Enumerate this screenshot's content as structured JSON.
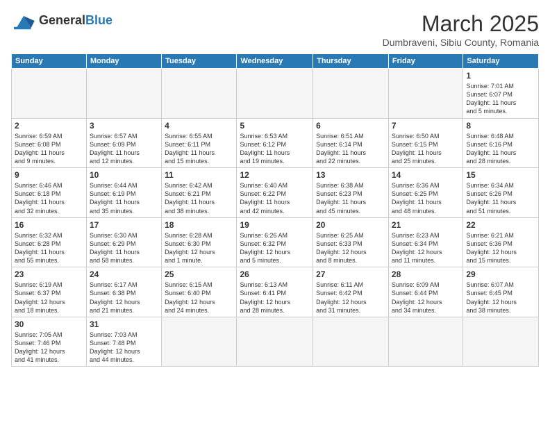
{
  "logo": {
    "text_general": "General",
    "text_blue": "Blue"
  },
  "header": {
    "month_year": "March 2025",
    "location": "Dumbraveni, Sibiu County, Romania"
  },
  "weekdays": [
    "Sunday",
    "Monday",
    "Tuesday",
    "Wednesday",
    "Thursday",
    "Friday",
    "Saturday"
  ],
  "weeks": [
    [
      null,
      null,
      null,
      null,
      null,
      null,
      {
        "day": "1",
        "info": "Sunrise: 7:01 AM\nSunset: 6:07 PM\nDaylight: 11 hours\nand 5 minutes."
      }
    ],
    [
      {
        "day": "2",
        "info": "Sunrise: 6:59 AM\nSunset: 6:08 PM\nDaylight: 11 hours\nand 9 minutes."
      },
      {
        "day": "3",
        "info": "Sunrise: 6:57 AM\nSunset: 6:09 PM\nDaylight: 11 hours\nand 12 minutes."
      },
      {
        "day": "4",
        "info": "Sunrise: 6:55 AM\nSunset: 6:11 PM\nDaylight: 11 hours\nand 15 minutes."
      },
      {
        "day": "5",
        "info": "Sunrise: 6:53 AM\nSunset: 6:12 PM\nDaylight: 11 hours\nand 19 minutes."
      },
      {
        "day": "6",
        "info": "Sunrise: 6:51 AM\nSunset: 6:14 PM\nDaylight: 11 hours\nand 22 minutes."
      },
      {
        "day": "7",
        "info": "Sunrise: 6:50 AM\nSunset: 6:15 PM\nDaylight: 11 hours\nand 25 minutes."
      },
      {
        "day": "8",
        "info": "Sunrise: 6:48 AM\nSunset: 6:16 PM\nDaylight: 11 hours\nand 28 minutes."
      }
    ],
    [
      {
        "day": "9",
        "info": "Sunrise: 6:46 AM\nSunset: 6:18 PM\nDaylight: 11 hours\nand 32 minutes."
      },
      {
        "day": "10",
        "info": "Sunrise: 6:44 AM\nSunset: 6:19 PM\nDaylight: 11 hours\nand 35 minutes."
      },
      {
        "day": "11",
        "info": "Sunrise: 6:42 AM\nSunset: 6:21 PM\nDaylight: 11 hours\nand 38 minutes."
      },
      {
        "day": "12",
        "info": "Sunrise: 6:40 AM\nSunset: 6:22 PM\nDaylight: 11 hours\nand 42 minutes."
      },
      {
        "day": "13",
        "info": "Sunrise: 6:38 AM\nSunset: 6:23 PM\nDaylight: 11 hours\nand 45 minutes."
      },
      {
        "day": "14",
        "info": "Sunrise: 6:36 AM\nSunset: 6:25 PM\nDaylight: 11 hours\nand 48 minutes."
      },
      {
        "day": "15",
        "info": "Sunrise: 6:34 AM\nSunset: 6:26 PM\nDaylight: 11 hours\nand 51 minutes."
      }
    ],
    [
      {
        "day": "16",
        "info": "Sunrise: 6:32 AM\nSunset: 6:28 PM\nDaylight: 11 hours\nand 55 minutes."
      },
      {
        "day": "17",
        "info": "Sunrise: 6:30 AM\nSunset: 6:29 PM\nDaylight: 11 hours\nand 58 minutes."
      },
      {
        "day": "18",
        "info": "Sunrise: 6:28 AM\nSunset: 6:30 PM\nDaylight: 12 hours\nand 1 minute."
      },
      {
        "day": "19",
        "info": "Sunrise: 6:26 AM\nSunset: 6:32 PM\nDaylight: 12 hours\nand 5 minutes."
      },
      {
        "day": "20",
        "info": "Sunrise: 6:25 AM\nSunset: 6:33 PM\nDaylight: 12 hours\nand 8 minutes."
      },
      {
        "day": "21",
        "info": "Sunrise: 6:23 AM\nSunset: 6:34 PM\nDaylight: 12 hours\nand 11 minutes."
      },
      {
        "day": "22",
        "info": "Sunrise: 6:21 AM\nSunset: 6:36 PM\nDaylight: 12 hours\nand 15 minutes."
      }
    ],
    [
      {
        "day": "23",
        "info": "Sunrise: 6:19 AM\nSunset: 6:37 PM\nDaylight: 12 hours\nand 18 minutes."
      },
      {
        "day": "24",
        "info": "Sunrise: 6:17 AM\nSunset: 6:38 PM\nDaylight: 12 hours\nand 21 minutes."
      },
      {
        "day": "25",
        "info": "Sunrise: 6:15 AM\nSunset: 6:40 PM\nDaylight: 12 hours\nand 24 minutes."
      },
      {
        "day": "26",
        "info": "Sunrise: 6:13 AM\nSunset: 6:41 PM\nDaylight: 12 hours\nand 28 minutes."
      },
      {
        "day": "27",
        "info": "Sunrise: 6:11 AM\nSunset: 6:42 PM\nDaylight: 12 hours\nand 31 minutes."
      },
      {
        "day": "28",
        "info": "Sunrise: 6:09 AM\nSunset: 6:44 PM\nDaylight: 12 hours\nand 34 minutes."
      },
      {
        "day": "29",
        "info": "Sunrise: 6:07 AM\nSunset: 6:45 PM\nDaylight: 12 hours\nand 38 minutes."
      }
    ],
    [
      {
        "day": "30",
        "info": "Sunrise: 7:05 AM\nSunset: 7:46 PM\nDaylight: 12 hours\nand 41 minutes."
      },
      {
        "day": "31",
        "info": "Sunrise: 7:03 AM\nSunset: 7:48 PM\nDaylight: 12 hours\nand 44 minutes."
      },
      null,
      null,
      null,
      null,
      null
    ]
  ]
}
